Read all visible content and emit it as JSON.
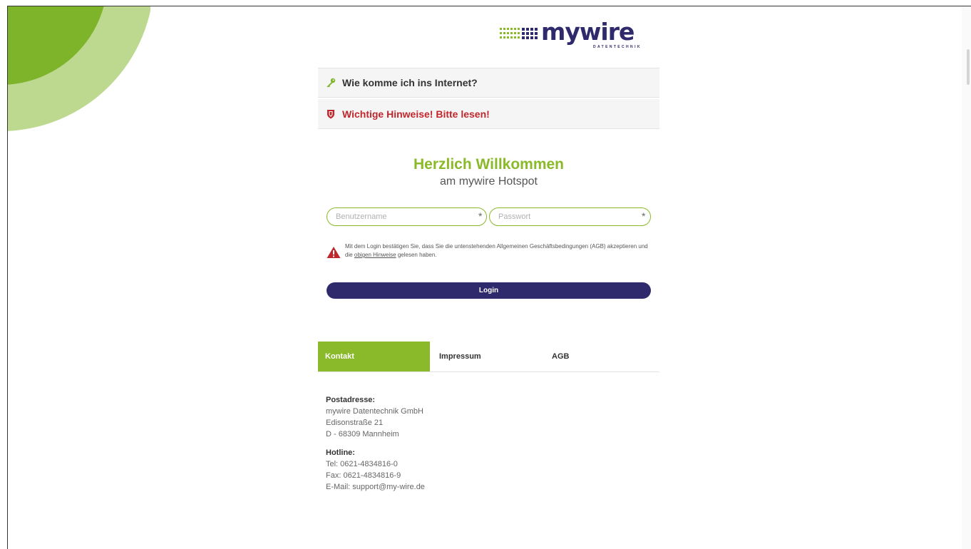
{
  "brand": {
    "name": "mywire",
    "subtitle": "DATENTECHNIK",
    "green": "#8ab929",
    "navy": "#2e2a6b",
    "red": "#c0272d"
  },
  "notices": [
    {
      "label": "Wie komme ich ins Internet?",
      "icon": "key-icon"
    },
    {
      "label": "Wichtige Hinweise! Bitte lesen!",
      "icon": "shield-icon"
    }
  ],
  "welcome": {
    "title": "Herzlich Willkommen",
    "subtitle": "am mywire Hotspot"
  },
  "form": {
    "username_placeholder": "Benutzername",
    "password_placeholder": "Passwort",
    "required_mark": "*",
    "legal_before": "Mit dem Login bestätigen Sie, dass Sie die untenstehenden Allgemeinen Geschäftsbedingungen (AGB) akzeptieren und die ",
    "legal_link": "obigen Hinweise",
    "legal_after": " gelesen haben.",
    "login_label": "Login"
  },
  "tabs": [
    {
      "label": "Kontakt",
      "active": true
    },
    {
      "label": "Impressum",
      "active": false
    },
    {
      "label": "AGB",
      "active": false
    }
  ],
  "contact": {
    "postal_heading": "Postadresse:",
    "company": "mywire Datentechnik GmbH",
    "street": "Edisonstraße 21",
    "city": "D - 68309 Mannheim",
    "hotline_heading": "Hotline:",
    "tel": "Tel: 0621-4834816-0",
    "fax": "Fax: 0621-4834816-9",
    "email": "E-Mail: support@my-wire.de"
  }
}
